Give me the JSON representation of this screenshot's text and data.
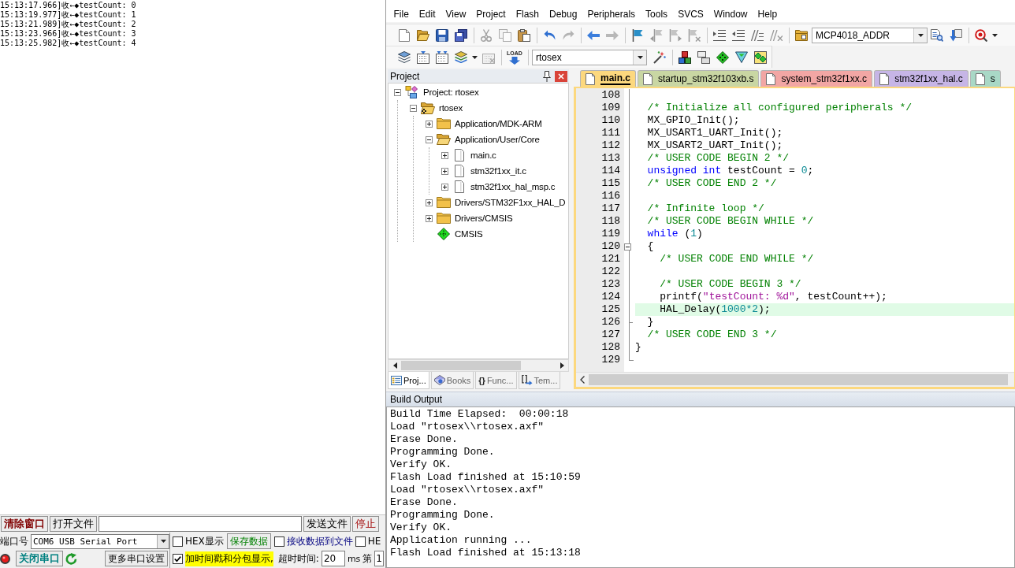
{
  "serial_tool": {
    "log_lines": [
      "15:13:17.966]收←◆testCount: 0",
      "15:13:19.977]收←◆testCount: 1",
      "15:13:21.989]收←◆testCount: 2",
      "15:13:23.966]收←◆testCount: 3",
      "15:13:25.982]收←◆testCount: 4"
    ],
    "send_bar": {
      "clear_button": "清除窗口",
      "open_file_button": "打开文件",
      "send_file_button": "发送文件",
      "stop_button": "停止"
    },
    "port": {
      "label": "端口号",
      "selected_port": "COM6 USB Serial Port",
      "open": true,
      "toggle_button": "关闭串口",
      "more_settings_button": "更多串口设置"
    },
    "options": {
      "hex_display": {
        "label": "HEX显示",
        "checked": false
      },
      "save_data_button": "保存数据",
      "receive_to_file": {
        "label": "接收数据到文件",
        "checked": false
      },
      "hex_send": {
        "label": "HE",
        "checked": false
      },
      "timestamp": {
        "label": "加时间戳和分包显示,",
        "checked": true
      },
      "timeout_label": "超时时间:",
      "timeout_value": "20",
      "timeout_unit": "ms",
      "index_label": "第",
      "index_value": "1"
    }
  },
  "ide": {
    "menu": [
      "File",
      "Edit",
      "View",
      "Project",
      "Flash",
      "Debug",
      "Peripherals",
      "Tools",
      "SVCS",
      "Window",
      "Help"
    ],
    "file_toolbar": {
      "search_text": "MCP4018_ADDR"
    },
    "build_toolbar": {
      "load_label": "LOAD",
      "target_select": "rtosex"
    },
    "project_panel": {
      "title": "Project",
      "tree": [
        {
          "label": "Project: rtosex",
          "kind": "project",
          "expanded": true,
          "children": [
            {
              "label": "rtosex",
              "kind": "target",
              "expanded": true,
              "children": [
                {
                  "label": "Application/MDK-ARM",
                  "kind": "folder",
                  "expanded": false
                },
                {
                  "label": "Application/User/Core",
                  "kind": "folder",
                  "expanded": true,
                  "children": [
                    {
                      "label": "main.c",
                      "kind": "file",
                      "expanded": false
                    },
                    {
                      "label": "stm32f1xx_it.c",
                      "kind": "file",
                      "expanded": false
                    },
                    {
                      "label": "stm32f1xx_hal_msp.c",
                      "kind": "file",
                      "expanded": false
                    }
                  ]
                },
                {
                  "label": "Drivers/STM32F1xx_HAL_D",
                  "kind": "folder",
                  "expanded": false
                },
                {
                  "label": "Drivers/CMSIS",
                  "kind": "folder",
                  "expanded": false
                },
                {
                  "label": "CMSIS",
                  "kind": "component"
                }
              ]
            }
          ]
        }
      ],
      "tabs": [
        {
          "label": "Proj...",
          "kind": "project",
          "selected": true
        },
        {
          "label": "Books",
          "kind": "books",
          "selected": false
        },
        {
          "label": "Func...",
          "kind": "functions",
          "glyph": "{}",
          "selected": false
        },
        {
          "label": "Tem...",
          "kind": "templates",
          "selected": false
        }
      ]
    },
    "editor": {
      "tabs": [
        {
          "label": "main.c",
          "selected": true,
          "color": "#fcd87e"
        },
        {
          "label": "startup_stm32f103xb.s",
          "selected": false,
          "color": "#c9d6a3"
        },
        {
          "label": "system_stm32f1xx.c",
          "selected": false,
          "color": "#f2a6a4"
        },
        {
          "label": "stm32f1xx_hal.c",
          "selected": false,
          "color": "#c6b5e6"
        },
        {
          "label": "s",
          "selected": false,
          "color": "#a9d8c6"
        }
      ],
      "lines": [
        {
          "number": "108",
          "current": false
        },
        {
          "number": "109",
          "current": false,
          "tokens": [
            {
              "kind": "comment",
              "text": "  /* Initialize all configured peripherals */"
            }
          ]
        },
        {
          "number": "110",
          "current": false,
          "tokens": [
            {
              "kind": "plain",
              "text": "  MX_GPIO_Init();"
            }
          ]
        },
        {
          "number": "111",
          "current": false,
          "tokens": [
            {
              "kind": "plain",
              "text": "  MX_USART1_UART_Init();"
            }
          ]
        },
        {
          "number": "112",
          "current": false,
          "tokens": [
            {
              "kind": "plain",
              "text": "  MX_USART2_UART_Init();"
            }
          ]
        },
        {
          "number": "113",
          "current": false,
          "tokens": [
            {
              "kind": "comment",
              "text": "  /* USER CODE BEGIN 2 */"
            }
          ]
        },
        {
          "number": "114",
          "current": false,
          "tokens": [
            {
              "kind": "keyword",
              "text": "  unsigned int"
            },
            {
              "kind": "plain",
              "text": " testCount = "
            },
            {
              "kind": "number",
              "text": "0"
            },
            {
              "kind": "plain",
              "text": ";"
            }
          ]
        },
        {
          "number": "115",
          "current": false,
          "tokens": [
            {
              "kind": "comment",
              "text": "  /* USER CODE END 2 */"
            }
          ]
        },
        {
          "number": "116",
          "current": false
        },
        {
          "number": "117",
          "current": false,
          "tokens": [
            {
              "kind": "comment",
              "text": "  /* Infinite loop */"
            }
          ]
        },
        {
          "number": "118",
          "current": false,
          "tokens": [
            {
              "kind": "comment",
              "text": "  /* USER CODE BEGIN WHILE */"
            }
          ]
        },
        {
          "number": "119",
          "current": false,
          "tokens": [
            {
              "kind": "keyword",
              "text": "  while"
            },
            {
              "kind": "plain",
              "text": " ("
            },
            {
              "kind": "number",
              "text": "1"
            },
            {
              "kind": "plain",
              "text": ")"
            }
          ]
        },
        {
          "number": "120",
          "current": false,
          "fold": {
            "kind": "box"
          },
          "tokens": [
            {
              "kind": "plain",
              "text": "  {"
            }
          ]
        },
        {
          "number": "121",
          "current": false,
          "tokens": [
            {
              "kind": "comment",
              "text": "    /* USER CODE END WHILE */"
            }
          ]
        },
        {
          "number": "122",
          "current": false
        },
        {
          "number": "123",
          "current": false,
          "tokens": [
            {
              "kind": "comment",
              "text": "    /* USER CODE BEGIN 3 */"
            }
          ]
        },
        {
          "number": "124",
          "current": false,
          "tokens": [
            {
              "kind": "plain",
              "text": "    printf("
            },
            {
              "kind": "string",
              "text": "\"testCount: %d\""
            },
            {
              "kind": "plain",
              "text": ", testCount++);"
            }
          ]
        },
        {
          "number": "125",
          "current": true,
          "tokens": [
            {
              "kind": "plain",
              "text": "    HAL_Delay("
            },
            {
              "kind": "number",
              "text": "1000*2"
            },
            {
              "kind": "plain",
              "text": ");"
            }
          ]
        },
        {
          "number": "126",
          "current": false,
          "fold": {
            "kind": "tick"
          },
          "tokens": [
            {
              "kind": "plain",
              "text": "  }"
            }
          ]
        },
        {
          "number": "127",
          "current": false,
          "tokens": [
            {
              "kind": "comment",
              "text": "  /* USER CODE END 3 */"
            }
          ]
        },
        {
          "number": "128",
          "current": false,
          "tokens": [
            {
              "kind": "plain",
              "text": "}"
            }
          ]
        },
        {
          "number": "129",
          "current": false,
          "fold": {
            "kind": "end"
          }
        }
      ]
    },
    "build_output": {
      "title": "Build Output",
      "lines": [
        "Build Time Elapsed:  00:00:18",
        "Load \"rtosex\\\\rtosex.axf\"",
        "Erase Done.",
        "Programming Done.",
        "Verify OK.",
        "Flash Load finished at 15:10:59",
        "Load \"rtosex\\\\rtosex.axf\"",
        "Erase Done.",
        "Programming Done.",
        "Verify OK.",
        "Application running ...",
        "Flash Load finished at 15:13:18"
      ]
    }
  }
}
